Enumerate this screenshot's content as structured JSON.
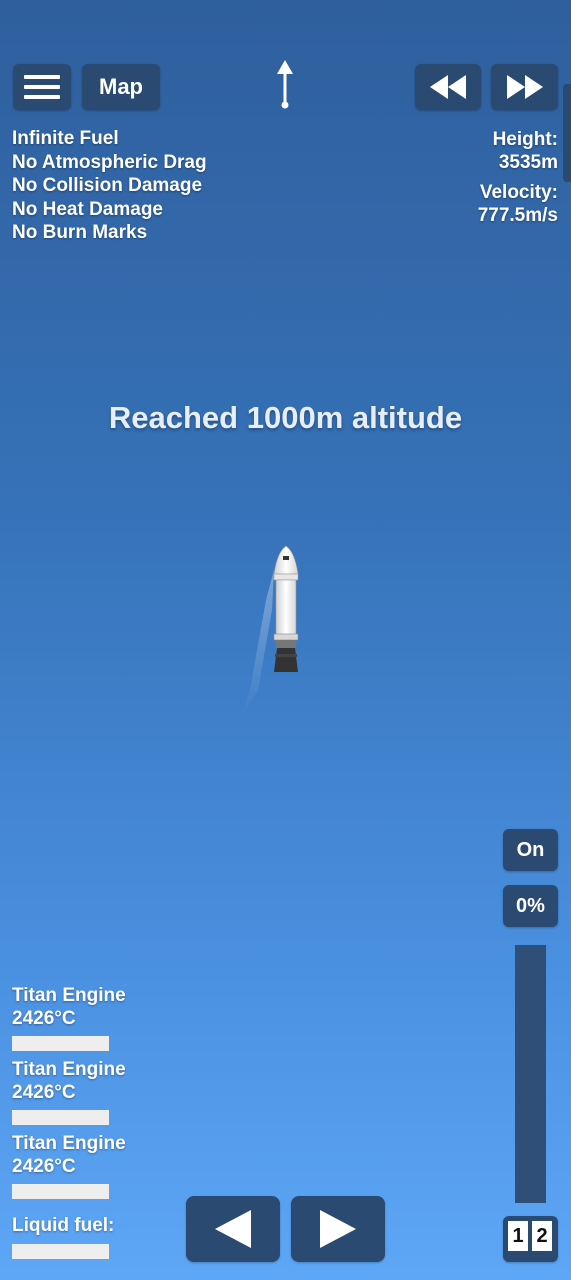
{
  "top_bar": {
    "menu_icon": "hamburger-menu-icon",
    "map_label": "Map",
    "direction_icon": "up-arrow-icon",
    "rewind_icon": "rewind-icon",
    "fast_forward_icon": "fast-forward-icon"
  },
  "cheats": [
    "Infinite Fuel",
    "No Atmospheric Drag",
    "No Collision Damage",
    "No Heat Damage",
    "No Burn Marks"
  ],
  "telemetry": {
    "height_label": "Height:",
    "height_value": "3535m",
    "velocity_label": "Velocity:",
    "velocity_value": "777.5m/s"
  },
  "message": "Reached 1000m altitude",
  "engines": [
    {
      "name": "Titan Engine",
      "temp": "2426°C"
    },
    {
      "name": "Titan Engine",
      "temp": "2426°C"
    },
    {
      "name": "Titan Engine",
      "temp": "2426°C"
    }
  ],
  "fuel": {
    "label": "Liquid fuel:"
  },
  "controls": {
    "engine_toggle_label": "On",
    "throttle_label": "0%",
    "throttle_level": 0,
    "left_icon": "rotate-left-arrow-icon",
    "right_icon": "rotate-right-arrow-icon",
    "stages": [
      "1",
      "2"
    ]
  },
  "colors": {
    "button_bg": "#2b4a72",
    "sky_top": "#2f5f9d",
    "sky_bottom": "#5ea7f6"
  }
}
